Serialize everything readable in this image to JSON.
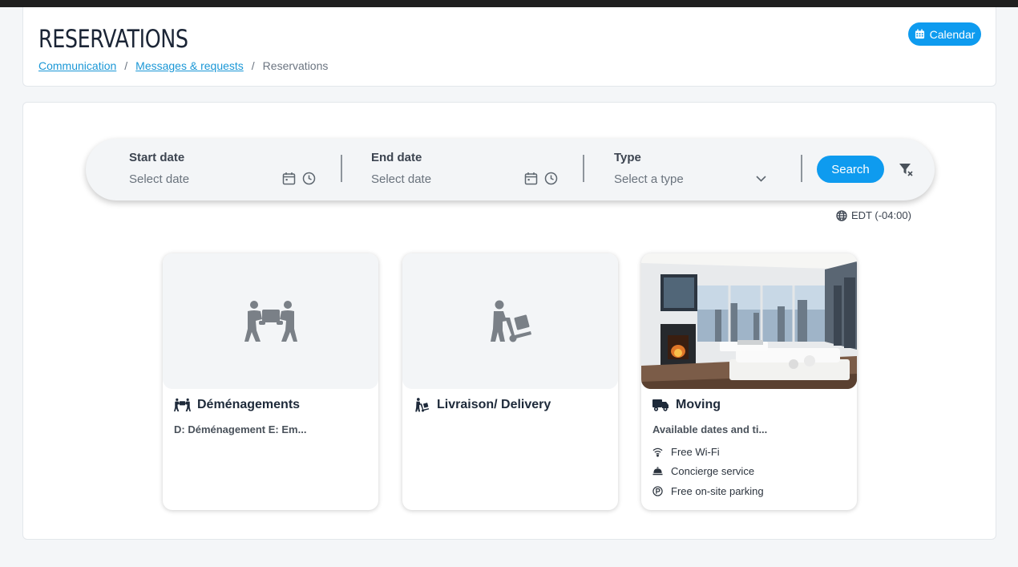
{
  "header": {
    "title": "RESERVATIONS",
    "calendar_button": "Calendar",
    "breadcrumb": [
      "Communication",
      "Messages & requests",
      "Reservations"
    ]
  },
  "search": {
    "start_label": "Start date",
    "start_placeholder": "Select date",
    "end_label": "End date",
    "end_placeholder": "Select date",
    "type_label": "Type",
    "type_placeholder": "Select a type",
    "search_button": "Search"
  },
  "timezone": "EDT (-04:00)",
  "cards": [
    {
      "title": "Déménagements",
      "description": "D: Déménagement E: Em...",
      "icon": "people-carry-box-icon"
    },
    {
      "title": "Livraison/ Delivery",
      "description": "",
      "icon": "person-dolly-icon"
    },
    {
      "title": "Moving",
      "description": "Available dates and ti...",
      "icon": "truck-icon",
      "amenities": [
        {
          "label": "Free Wi-Fi",
          "icon": "wifi-icon"
        },
        {
          "label": "Concierge service",
          "icon": "concierge-bell-icon"
        },
        {
          "label": "Free on-site parking",
          "icon": "parking-icon"
        }
      ]
    }
  ],
  "colors": {
    "accent": "#0e9bef",
    "link": "#1a97d6",
    "icon_gray": "#7a8087"
  }
}
